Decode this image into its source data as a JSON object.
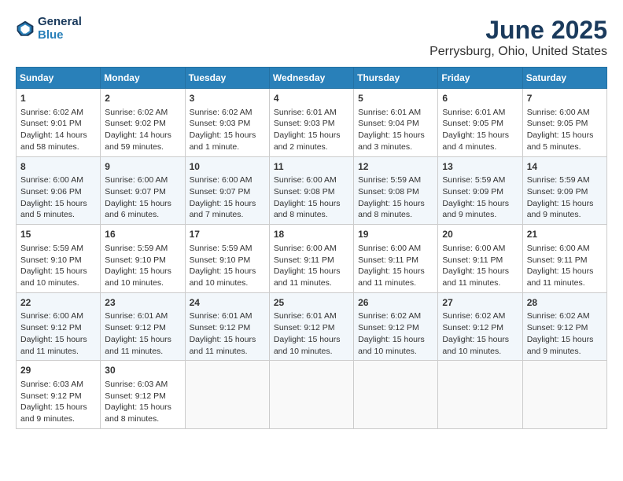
{
  "header": {
    "logo_line1": "General",
    "logo_line2": "Blue",
    "month": "June 2025",
    "location": "Perrysburg, Ohio, United States"
  },
  "weekdays": [
    "Sunday",
    "Monday",
    "Tuesday",
    "Wednesday",
    "Thursday",
    "Friday",
    "Saturday"
  ],
  "weeks": [
    [
      {
        "day": "1",
        "lines": [
          "Sunrise: 6:02 AM",
          "Sunset: 9:01 PM",
          "Daylight: 14 hours",
          "and 58 minutes."
        ]
      },
      {
        "day": "2",
        "lines": [
          "Sunrise: 6:02 AM",
          "Sunset: 9:02 PM",
          "Daylight: 14 hours",
          "and 59 minutes."
        ]
      },
      {
        "day": "3",
        "lines": [
          "Sunrise: 6:02 AM",
          "Sunset: 9:03 PM",
          "Daylight: 15 hours",
          "and 1 minute."
        ]
      },
      {
        "day": "4",
        "lines": [
          "Sunrise: 6:01 AM",
          "Sunset: 9:03 PM",
          "Daylight: 15 hours",
          "and 2 minutes."
        ]
      },
      {
        "day": "5",
        "lines": [
          "Sunrise: 6:01 AM",
          "Sunset: 9:04 PM",
          "Daylight: 15 hours",
          "and 3 minutes."
        ]
      },
      {
        "day": "6",
        "lines": [
          "Sunrise: 6:01 AM",
          "Sunset: 9:05 PM",
          "Daylight: 15 hours",
          "and 4 minutes."
        ]
      },
      {
        "day": "7",
        "lines": [
          "Sunrise: 6:00 AM",
          "Sunset: 9:05 PM",
          "Daylight: 15 hours",
          "and 5 minutes."
        ]
      }
    ],
    [
      {
        "day": "8",
        "lines": [
          "Sunrise: 6:00 AM",
          "Sunset: 9:06 PM",
          "Daylight: 15 hours",
          "and 5 minutes."
        ]
      },
      {
        "day": "9",
        "lines": [
          "Sunrise: 6:00 AM",
          "Sunset: 9:07 PM",
          "Daylight: 15 hours",
          "and 6 minutes."
        ]
      },
      {
        "day": "10",
        "lines": [
          "Sunrise: 6:00 AM",
          "Sunset: 9:07 PM",
          "Daylight: 15 hours",
          "and 7 minutes."
        ]
      },
      {
        "day": "11",
        "lines": [
          "Sunrise: 6:00 AM",
          "Sunset: 9:08 PM",
          "Daylight: 15 hours",
          "and 8 minutes."
        ]
      },
      {
        "day": "12",
        "lines": [
          "Sunrise: 5:59 AM",
          "Sunset: 9:08 PM",
          "Daylight: 15 hours",
          "and 8 minutes."
        ]
      },
      {
        "day": "13",
        "lines": [
          "Sunrise: 5:59 AM",
          "Sunset: 9:09 PM",
          "Daylight: 15 hours",
          "and 9 minutes."
        ]
      },
      {
        "day": "14",
        "lines": [
          "Sunrise: 5:59 AM",
          "Sunset: 9:09 PM",
          "Daylight: 15 hours",
          "and 9 minutes."
        ]
      }
    ],
    [
      {
        "day": "15",
        "lines": [
          "Sunrise: 5:59 AM",
          "Sunset: 9:10 PM",
          "Daylight: 15 hours",
          "and 10 minutes."
        ]
      },
      {
        "day": "16",
        "lines": [
          "Sunrise: 5:59 AM",
          "Sunset: 9:10 PM",
          "Daylight: 15 hours",
          "and 10 minutes."
        ]
      },
      {
        "day": "17",
        "lines": [
          "Sunrise: 5:59 AM",
          "Sunset: 9:10 PM",
          "Daylight: 15 hours",
          "and 10 minutes."
        ]
      },
      {
        "day": "18",
        "lines": [
          "Sunrise: 6:00 AM",
          "Sunset: 9:11 PM",
          "Daylight: 15 hours",
          "and 11 minutes."
        ]
      },
      {
        "day": "19",
        "lines": [
          "Sunrise: 6:00 AM",
          "Sunset: 9:11 PM",
          "Daylight: 15 hours",
          "and 11 minutes."
        ]
      },
      {
        "day": "20",
        "lines": [
          "Sunrise: 6:00 AM",
          "Sunset: 9:11 PM",
          "Daylight: 15 hours",
          "and 11 minutes."
        ]
      },
      {
        "day": "21",
        "lines": [
          "Sunrise: 6:00 AM",
          "Sunset: 9:11 PM",
          "Daylight: 15 hours",
          "and 11 minutes."
        ]
      }
    ],
    [
      {
        "day": "22",
        "lines": [
          "Sunrise: 6:00 AM",
          "Sunset: 9:12 PM",
          "Daylight: 15 hours",
          "and 11 minutes."
        ]
      },
      {
        "day": "23",
        "lines": [
          "Sunrise: 6:01 AM",
          "Sunset: 9:12 PM",
          "Daylight: 15 hours",
          "and 11 minutes."
        ]
      },
      {
        "day": "24",
        "lines": [
          "Sunrise: 6:01 AM",
          "Sunset: 9:12 PM",
          "Daylight: 15 hours",
          "and 11 minutes."
        ]
      },
      {
        "day": "25",
        "lines": [
          "Sunrise: 6:01 AM",
          "Sunset: 9:12 PM",
          "Daylight: 15 hours",
          "and 10 minutes."
        ]
      },
      {
        "day": "26",
        "lines": [
          "Sunrise: 6:02 AM",
          "Sunset: 9:12 PM",
          "Daylight: 15 hours",
          "and 10 minutes."
        ]
      },
      {
        "day": "27",
        "lines": [
          "Sunrise: 6:02 AM",
          "Sunset: 9:12 PM",
          "Daylight: 15 hours",
          "and 10 minutes."
        ]
      },
      {
        "day": "28",
        "lines": [
          "Sunrise: 6:02 AM",
          "Sunset: 9:12 PM",
          "Daylight: 15 hours",
          "and 9 minutes."
        ]
      }
    ],
    [
      {
        "day": "29",
        "lines": [
          "Sunrise: 6:03 AM",
          "Sunset: 9:12 PM",
          "Daylight: 15 hours",
          "and 9 minutes."
        ]
      },
      {
        "day": "30",
        "lines": [
          "Sunrise: 6:03 AM",
          "Sunset: 9:12 PM",
          "Daylight: 15 hours",
          "and 8 minutes."
        ]
      },
      {
        "day": "",
        "lines": []
      },
      {
        "day": "",
        "lines": []
      },
      {
        "day": "",
        "lines": []
      },
      {
        "day": "",
        "lines": []
      },
      {
        "day": "",
        "lines": []
      }
    ]
  ]
}
